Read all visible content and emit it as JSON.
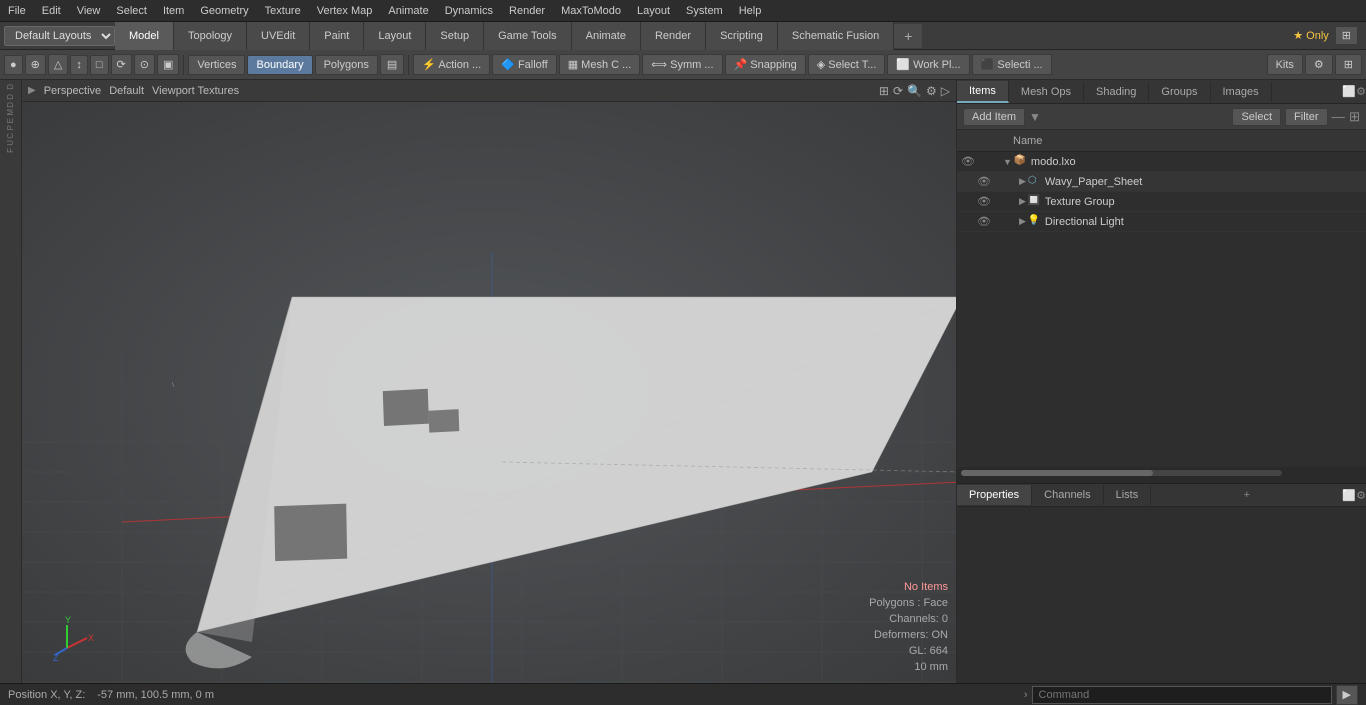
{
  "menubar": {
    "items": [
      "File",
      "Edit",
      "View",
      "Select",
      "Item",
      "Geometry",
      "Texture",
      "Vertex Map",
      "Animate",
      "Dynamics",
      "Render",
      "MaxToModo",
      "Layout",
      "System",
      "Help"
    ]
  },
  "toolbar1": {
    "layout_dropdown": "Default Layouts",
    "tabs": [
      "Model",
      "Topology",
      "UVEdit",
      "Paint",
      "Layout",
      "Setup",
      "Game Tools",
      "Animate",
      "Render",
      "Scripting",
      "Schematic Fusion"
    ],
    "active_tab": "Model"
  },
  "toolbar2": {
    "left_buttons": [
      {
        "label": "●",
        "icon": "circle-icon",
        "tooltip": ""
      },
      {
        "label": "⊕",
        "icon": "crosshair-icon",
        "tooltip": ""
      },
      {
        "label": "◬",
        "icon": "lasso-icon",
        "tooltip": ""
      },
      {
        "label": "↕",
        "icon": "transform-icon",
        "tooltip": ""
      },
      {
        "label": "□",
        "icon": "box-icon",
        "tooltip": ""
      },
      {
        "label": "⟳",
        "icon": "rotate-icon",
        "tooltip": ""
      },
      {
        "label": "⊙",
        "icon": "sphere-icon",
        "tooltip": ""
      },
      {
        "label": "▣",
        "icon": "square-icon",
        "tooltip": ""
      },
      {
        "label": "Vertices",
        "icon": "vertices-icon"
      },
      {
        "label": "Boundary",
        "icon": "boundary-icon"
      },
      {
        "label": "Polygons",
        "icon": "polygons-icon"
      },
      {
        "label": "▤",
        "icon": "mesh-icon"
      },
      {
        "label": "Action ...",
        "icon": "action-icon"
      },
      {
        "label": "Falloff",
        "icon": "falloff-icon"
      },
      {
        "label": "Mesh C ...",
        "icon": "mesh-c-icon"
      },
      {
        "label": "Symm ...",
        "icon": "symm-icon"
      },
      {
        "label": "Snapping",
        "icon": "snapping-icon"
      },
      {
        "label": "Select T...",
        "icon": "select-t-icon"
      },
      {
        "label": "Work Pl...",
        "icon": "work-pl-icon"
      },
      {
        "label": "Selecti ...",
        "icon": "selecti-icon"
      }
    ],
    "right_buttons": [
      {
        "label": "Kits",
        "icon": "kits-icon"
      },
      {
        "label": "⚙",
        "icon": "settings-icon"
      },
      {
        "label": "⊞",
        "icon": "grid-icon"
      }
    ]
  },
  "viewport": {
    "label_perspective": "Perspective",
    "label_default": "Default",
    "label_textures": "Viewport Textures"
  },
  "scene_info": {
    "no_items": "No Items",
    "polygons": "Polygons : Face",
    "channels": "Channels: 0",
    "deformers": "Deformers: ON",
    "gl": "GL: 664",
    "unit": "10 mm"
  },
  "statusbar": {
    "position": "Position X, Y, Z:",
    "coords": "-57 mm, 100.5 mm, 0 m",
    "command_placeholder": "Command",
    "arrow": "›"
  },
  "right_panel": {
    "items_tabs": [
      "Items",
      "Mesh Ops",
      "Shading",
      "Groups",
      "Images"
    ],
    "active_items_tab": "Items",
    "add_item_label": "Add Item",
    "select_label": "Select",
    "filter_label": "Filter",
    "name_col": "Name",
    "items": [
      {
        "name": "modo.lxo",
        "type": "scene",
        "depth": 0,
        "expanded": true,
        "icon": "📦"
      },
      {
        "name": "Wavy_Paper_Sheet",
        "type": "mesh",
        "depth": 1,
        "expanded": false,
        "icon": "⬡"
      },
      {
        "name": "Texture Group",
        "type": "texture",
        "depth": 1,
        "expanded": false,
        "icon": "🔲"
      },
      {
        "name": "Directional Light",
        "type": "light",
        "depth": 1,
        "expanded": false,
        "icon": "💡"
      }
    ],
    "props_tabs": [
      "Properties",
      "Channels",
      "Lists"
    ],
    "active_props_tab": "Properties"
  }
}
